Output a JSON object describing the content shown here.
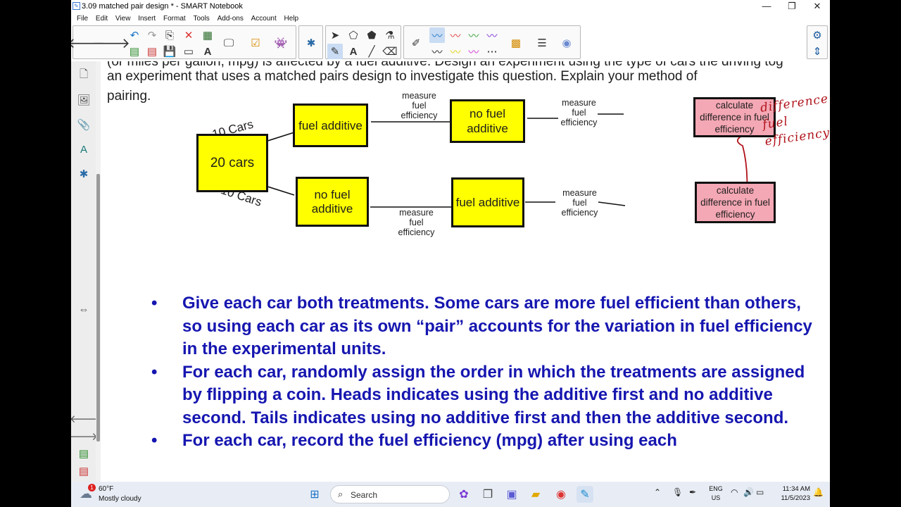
{
  "window": {
    "title": "3.09 matched pair design * - SMART Notebook",
    "controls": [
      "—",
      "❐",
      "✕"
    ]
  },
  "menu": [
    "File",
    "Edit",
    "View",
    "Insert",
    "Format",
    "Tools",
    "Add-ons",
    "Account",
    "Help"
  ],
  "toolbar": {
    "icons": [
      "back-arrow-icon",
      "forward-arrow-icon",
      "undo-icon",
      "redo-icon",
      "screen-capture-icon",
      "delete-icon",
      "table-icon",
      "display-icon",
      "text-icon",
      "check-icon",
      "activity-icon",
      "addon-icon",
      "select-icon",
      "shape-icon",
      "fill-icon",
      "pen-icon",
      "creative-pen-icon",
      "text-tool-icon",
      "eraser-icon",
      "line-icon",
      "magic-pen-icon",
      "grid-icon",
      "measure-icon",
      "3d-icon",
      "settings-icon"
    ]
  },
  "question": {
    "cut_line": "(or miles per gallon, mpg) is affected by a fuel additive. Design an experiment using the type of cars the driving tog",
    "line1": "an experiment that uses a matched pairs design to investigate this question. Explain your method of",
    "line2": "pairing."
  },
  "diagram": {
    "start": "20 cars",
    "branch_top": "10 Cars",
    "branch_bottom": "10 Cars",
    "top_first": "fuel additive",
    "top_second": "no fuel additive",
    "top_result": "calculate difference in fuel efficiency",
    "bottom_first": "no fuel additive",
    "bottom_second": "fuel additive",
    "bottom_result": "calculate difference in fuel efficiency",
    "measure": "measure fuel efficiency",
    "handwritten_note": "difference fuel efficiency"
  },
  "bullets": [
    "Give each car both treatments. Some cars are more fuel efficient than others, so using each car as its own “pair” accounts for the variation in fuel efficiency in the experimental units.",
    "For each car, randomly assign the order in which the treatments are assigned by flipping a coin. Heads indicates using the additive first and no additive second. Tails indicates using no additive first and then the additive second.",
    "For each car, record the fuel efficiency (mpg) after using each"
  ],
  "taskbar": {
    "weather_temp": "60°F",
    "weather_desc": "Mostly cloudy",
    "weather_badge": "1",
    "search_placeholder": "Search",
    "lang_top": "ENG",
    "lang_bottom": "US",
    "time": "11:34 AM",
    "date": "11/5/2023"
  },
  "colors": {
    "box_yellow": "#ffff00",
    "box_pink": "#f4a7b4",
    "bullet_blue": "#1616b0",
    "ink_red": "#b0121a"
  }
}
